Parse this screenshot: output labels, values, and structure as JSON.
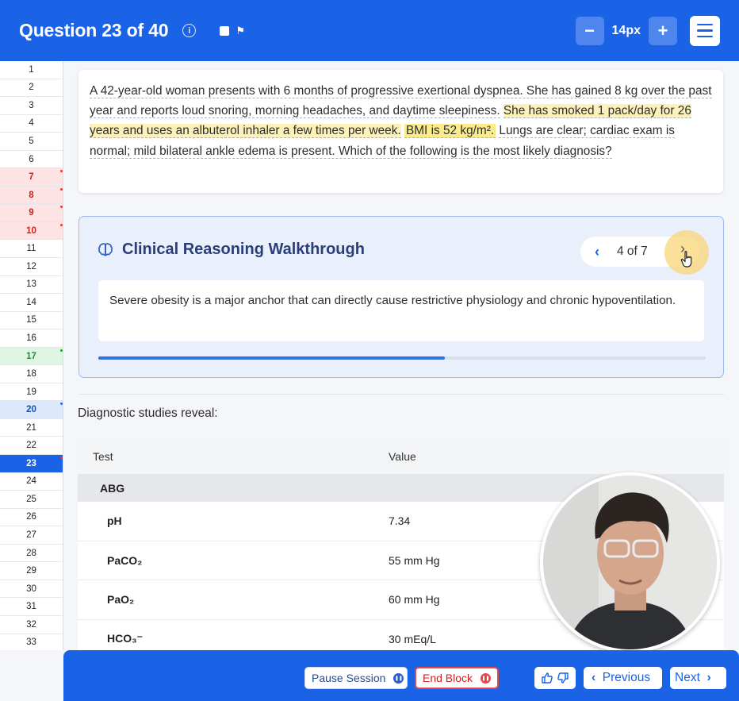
{
  "header": {
    "title": "Question 23 of 40",
    "info_icon": "info-icon",
    "flag_icon": "flag-icon",
    "zoom_minus": "−",
    "zoom_value": "14px",
    "zoom_plus": "+",
    "menu_icon": "hamburger-menu-icon",
    "colors": {
      "accent": "#1a63e6"
    }
  },
  "sidebar": {
    "numbers": [
      "1",
      "2",
      "3",
      "4",
      "5",
      "6",
      "7",
      "8",
      "9",
      "10",
      "11",
      "12",
      "13",
      "14",
      "15",
      "16",
      "17",
      "18",
      "19",
      "20",
      "21",
      "22",
      "23",
      "24",
      "25",
      "26",
      "27",
      "28",
      "29",
      "30",
      "31",
      "32",
      "33"
    ],
    "states": {
      "red": [
        "7",
        "8",
        "9",
        "10"
      ],
      "green": [
        "17"
      ],
      "blue": [
        "20"
      ],
      "active": "23"
    }
  },
  "question": {
    "parts": [
      "A 42-year-old woman presents with 6 months of progressive exertional dyspnea. She has gained 8 kg over the past year and reports loud snoring, morning headaches, and daytime sleepiness.",
      " ",
      "She has smoked 1 pack/day for 26 years and uses an albuterol inhaler a few times per week.",
      " ",
      "BMI is 52 kg/m².",
      " ",
      "Lungs are clear; cardiac exam is normal; mild bilateral ankle edema is present. Which of the following is the most likely diagnosis?"
    ]
  },
  "walkthrough": {
    "title": "Clinical Reasoning Walkthrough",
    "icon": "brain-icon",
    "prev_icon": "‹",
    "page_label": "4 of 7",
    "next_icon": "›",
    "body": "Severe obesity is a major anchor that can directly cause restrictive physiology and chronic hypoventilation.",
    "progress_fraction": 0.57
  },
  "diagnostics": {
    "intro": "Diagnostic studies reveal:",
    "columns": [
      "Test",
      "Value"
    ],
    "group": "ABG",
    "rows": [
      {
        "test": "pH",
        "value": "7.34"
      },
      {
        "test": "PaCO₂",
        "value": "55 mm Hg"
      },
      {
        "test": "PaO₂",
        "value": "60 mm Hg"
      },
      {
        "test": "HCO₃⁻",
        "value": "30 mEq/L"
      }
    ]
  },
  "footer": {
    "pause_label": "Pause Session",
    "end_label": "End Block",
    "previous_label": "Previous",
    "next_label": "Next",
    "thumbs_icons": [
      "thumbs-up-icon",
      "thumbs-down-icon"
    ]
  }
}
